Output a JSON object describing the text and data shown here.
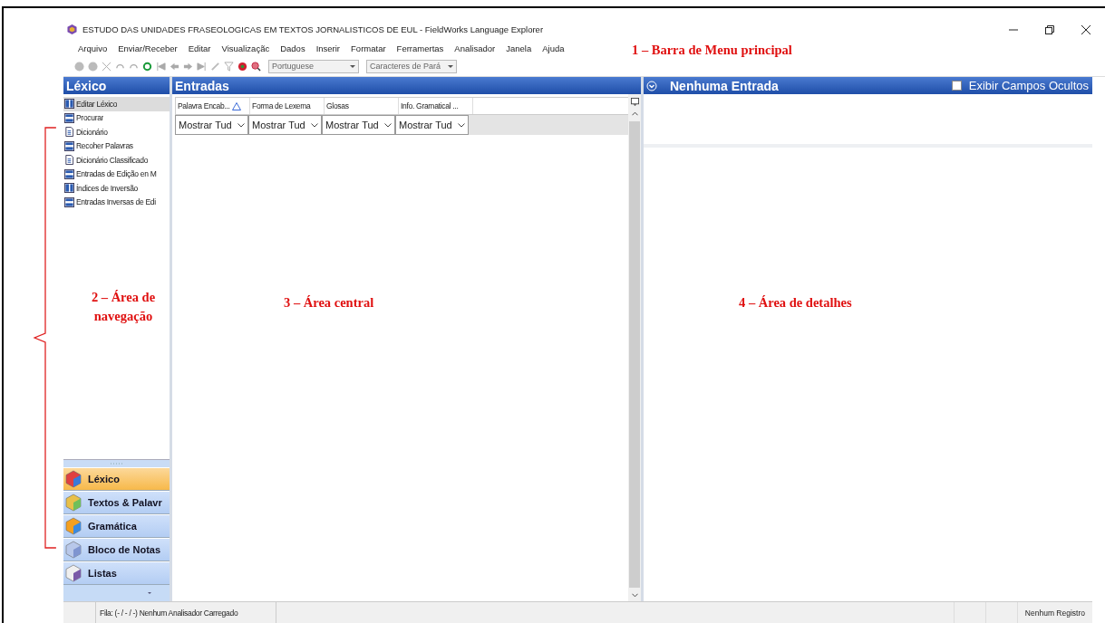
{
  "window": {
    "title": "ESTUDO DAS UNIDADES FRASEOLOGICAS EM TEXTOS JORNALISTICOS DE EUL - FieldWorks Language Explorer"
  },
  "menu": [
    "Arquivo",
    "Enviar/Receber",
    "Editar",
    "Visualizaçãc",
    "Dados",
    "Inserir",
    "Formatar",
    "Ferramertas",
    "Analisador",
    "Janela",
    "Ajuda"
  ],
  "toolbar": {
    "combos": [
      "Portuguese",
      "Caracteres de Pará"
    ]
  },
  "navigation": {
    "title": "Léxico",
    "items": [
      {
        "label": "Editar Léxico",
        "kind": "split",
        "selected": true
      },
      {
        "label": "Procurar",
        "kind": "list",
        "selected": false
      },
      {
        "label": "Dicionário",
        "kind": "doc",
        "selected": false
      },
      {
        "label": "Recoher Palavras",
        "kind": "list",
        "selected": false
      },
      {
        "label": "Dicionário Classificado",
        "kind": "doc",
        "selected": false
      },
      {
        "label": "Entradas de Edição en M",
        "kind": "list",
        "selected": false
      },
      {
        "label": "Índices de Inversão",
        "kind": "split",
        "selected": false
      },
      {
        "label": "Entradas Inversas de Edi",
        "kind": "list",
        "selected": false
      }
    ],
    "sections": [
      {
        "label": "Léxico",
        "kind": "lexicon",
        "selected": true
      },
      {
        "label": "Textos & Palavr",
        "kind": "texts",
        "selected": false
      },
      {
        "label": "Gramática",
        "kind": "grammar",
        "selected": false
      },
      {
        "label": "Bloco de Notas",
        "kind": "notebook",
        "selected": false
      },
      {
        "label": "Listas",
        "kind": "lists",
        "selected": false
      }
    ]
  },
  "entries": {
    "title": "Entradas",
    "columns": [
      {
        "label": "Palavra Encab...",
        "sorted": true,
        "filter": "Mostrar Tud"
      },
      {
        "label": "Forma de Lexema",
        "sorted": false,
        "filter": "Mostrar Tud"
      },
      {
        "label": "Glosas",
        "sorted": false,
        "filter": "Mostrar Tud"
      },
      {
        "label": "Info. Gramatical ...",
        "sorted": false,
        "filter": "Mostrar Tud"
      }
    ]
  },
  "details": {
    "title": "Nenhuma Entrada",
    "show_hidden": {
      "label": "Exibir Campos Ocultos",
      "checked": false
    }
  },
  "status_bar": {
    "left": "Fila: (- / - / -) Nenhum Analisador Carregado",
    "right": "Nenhum Registro"
  },
  "annotations": [
    {
      "text": "1 – Barra de Menu principal",
      "kind": "menu"
    },
    {
      "text": "2 – Área de navegação",
      "kind": "navigation"
    },
    {
      "text": "3 – Área central",
      "kind": "center"
    },
    {
      "text": "4 – Área de detalhes",
      "kind": "details"
    }
  ]
}
